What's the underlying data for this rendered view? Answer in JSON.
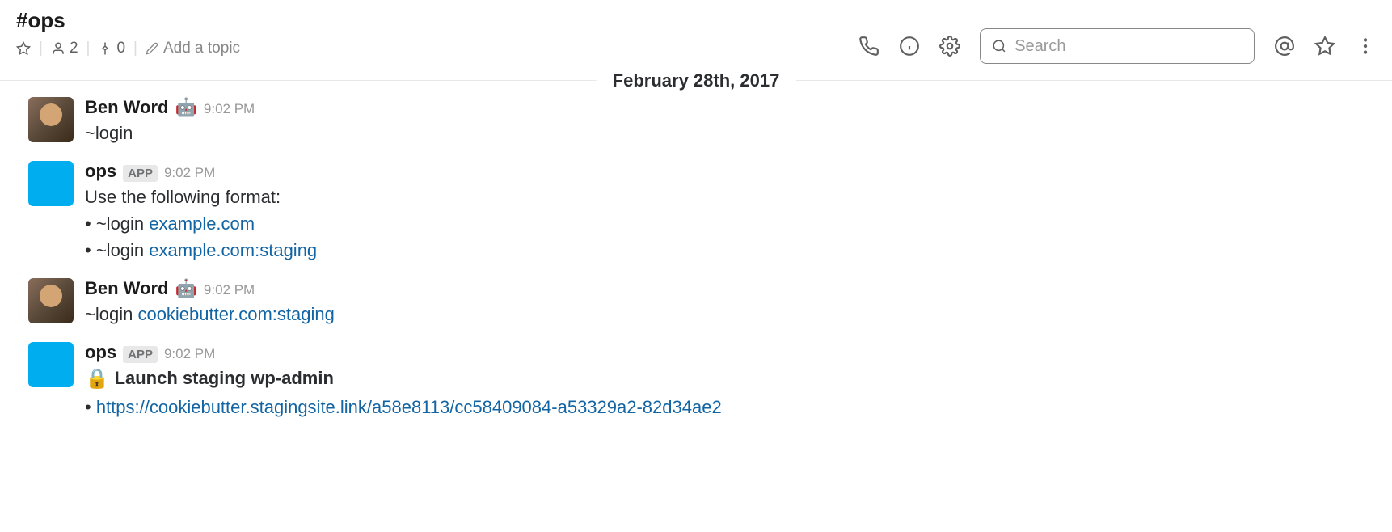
{
  "header": {
    "channel_name": "#ops",
    "member_count": "2",
    "pin_count": "0",
    "add_topic": "Add a topic",
    "search_placeholder": "Search",
    "date_divider": "February 28th, 2017"
  },
  "messages": [
    {
      "author": "Ben Word",
      "emoji": "🤖",
      "timestamp": "9:02 PM",
      "avatar_type": "user",
      "lines": [
        {
          "prefix": "",
          "text": "~login",
          "link": ""
        }
      ]
    },
    {
      "author": "ops",
      "badge": "APP",
      "timestamp": "9:02 PM",
      "avatar_type": "bot",
      "lines": [
        {
          "prefix": "",
          "text": "Use the following format:",
          "link": ""
        },
        {
          "prefix": "bullet",
          "text": "~login ",
          "link": "example.com"
        },
        {
          "prefix": "bullet",
          "text": "~login ",
          "link": "example.com:staging"
        }
      ]
    },
    {
      "author": "Ben Word",
      "emoji": "🤖",
      "timestamp": "9:02 PM",
      "avatar_type": "user",
      "lines": [
        {
          "prefix": "",
          "text": "~login ",
          "link": "cookiebutter.com:staging"
        }
      ]
    },
    {
      "author": "ops",
      "badge": "APP",
      "timestamp": "9:02 PM",
      "avatar_type": "bot",
      "lines": [
        {
          "prefix": "lock",
          "text": "Launch staging wp-admin",
          "link": "",
          "bold": true
        },
        {
          "prefix": "bullet",
          "text": "",
          "link": "https://cookiebutter.stagingsite.link/a58e8113/cc58409084-a53329a2-82d34ae2"
        }
      ]
    }
  ]
}
